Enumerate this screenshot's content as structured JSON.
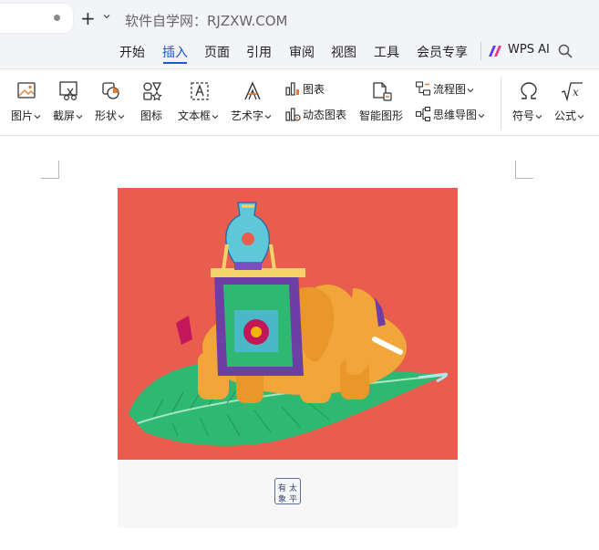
{
  "tabbar": {
    "new_tab_symbol": "+",
    "address": "软件自学网：RJZXW.COM"
  },
  "menu": {
    "items": [
      "开始",
      "插入",
      "页面",
      "引用",
      "审阅",
      "视图",
      "工具",
      "会员专享"
    ],
    "active_index": 1,
    "ai_label": "WPS AI"
  },
  "ribbon": {
    "picture": "图片",
    "screenshot": "截屏",
    "shapes": "形状",
    "icons": "图标",
    "textbox": "文本框",
    "wordart": "艺术字",
    "chart": "图表",
    "dynamic_chart": "动态图表",
    "smart_graphic": "智能图形",
    "flowchart": "流程图",
    "mindmap": "思维导图",
    "symbol": "符号",
    "formula": "公式"
  },
  "document": {
    "seal_chars": [
      "有",
      "太",
      "象",
      "平"
    ]
  },
  "colors": {
    "accent": "#1a56d6",
    "image_background": "#e85d4e",
    "leaf": "#2eb872",
    "elephant": "#f2a63a",
    "saddle": "#6d3ea3",
    "vase": "#5ec8d8"
  }
}
